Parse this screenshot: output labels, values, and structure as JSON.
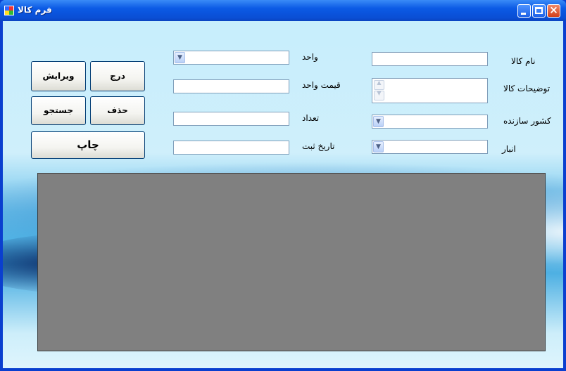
{
  "window": {
    "title": "فرم کالا",
    "controls": [
      "minimize",
      "maximize",
      "close"
    ]
  },
  "form": {
    "right_column": {
      "product_name_label": "نام کالا",
      "product_name_value": "",
      "description_label": "توضیحات کالا",
      "description_value": "",
      "manufacturer_country_label": "کشور سازنده",
      "manufacturer_country_value": "",
      "warehouse_label": "انبار",
      "warehouse_value": ""
    },
    "middle_column": {
      "unit_label": "واحد",
      "unit_value": "",
      "unit_price_label": "قیمت واحد",
      "unit_price_value": "",
      "quantity_label": "تعداد",
      "quantity_value": "",
      "registration_date_label": "تاریخ ثبت",
      "registration_date_value": ""
    },
    "buttons": {
      "insert": "درج",
      "edit": "ویرایش",
      "delete": "حذف",
      "search": "جستجو",
      "print": "چاپ"
    }
  },
  "icons": {
    "app": "app-window-icon",
    "dropdown": "chevron-down-icon",
    "spin_up": "chevron-up-icon",
    "spin_down": "chevron-down-icon"
  },
  "colors": {
    "title_bar": "#0b5ae5",
    "grid_background": "#808080",
    "client_background": "#c7eefc"
  }
}
